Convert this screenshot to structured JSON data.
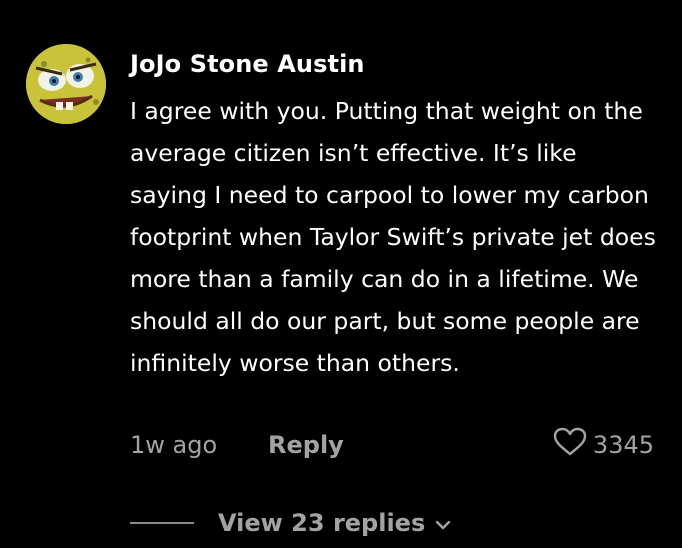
{
  "comment": {
    "username": "JoJo Stone Austin",
    "text": "I agree with you. Putting that weight on the average citizen isn’t effective. It’s like saying I need to carpool to lower my carbon footprint when Taylor Swift’s private jet does more than a family can do in a lifetime. We should all do our part, but some people are infinitely worse than others.",
    "time_ago": "1w ago",
    "reply_label": "Reply",
    "like_count": "3345",
    "like_icon": "heart-icon",
    "view_replies_label": "View 23 replies",
    "view_replies_icon": "chevron-down-icon"
  },
  "colors": {
    "background": "#000000",
    "text_primary": "#ffffff",
    "text_secondary": "#a3a3a3"
  }
}
